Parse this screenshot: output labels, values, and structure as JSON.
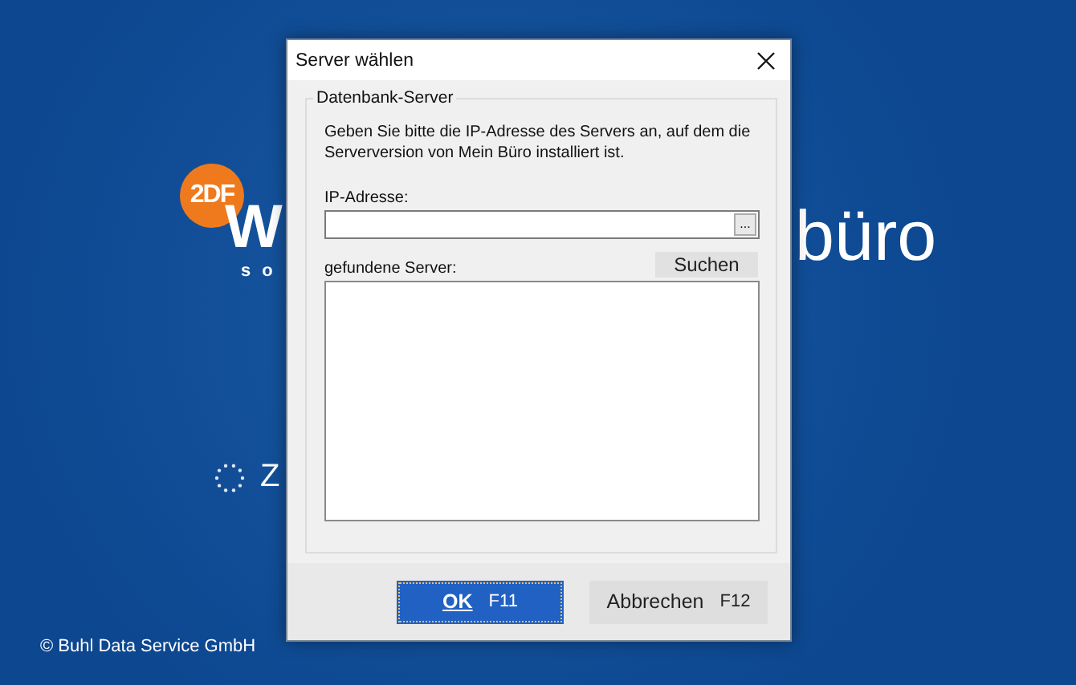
{
  "splash": {
    "logo_mark": "2DF",
    "logo_letter": "W",
    "brand_tail": "büro",
    "tagline": "s o",
    "status": "Z",
    "copyright": "© Buhl Data Service GmbH"
  },
  "dialog": {
    "title": "Server wählen",
    "group_title": "Datenbank-Server",
    "description": "Geben Sie bitte die IP-Adresse des Servers an, auf dem die Serverversion von Mein Büro installiert ist.",
    "ip_label": "IP-Adresse:",
    "browse_button": "...",
    "found_label": "gefundene Server:",
    "search_button": "Suchen",
    "buttons": [
      {
        "label": "OK",
        "shortcut": "F11",
        "selected": true
      },
      {
        "label": "Abbrechen",
        "shortcut": "F12",
        "selected": false
      }
    ]
  }
}
